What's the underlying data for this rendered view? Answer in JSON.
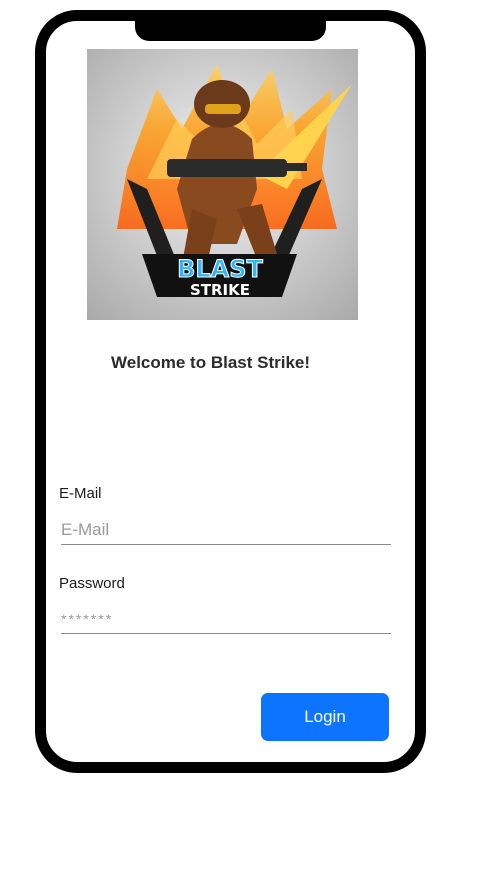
{
  "app": {
    "logo_top_text": "BLAST",
    "logo_bottom_text": "STRIKE",
    "welcome": "Welcome to Blast Strike!"
  },
  "form": {
    "email_label": "E-Mail",
    "email_placeholder": "E-Mail",
    "email_value": "",
    "password_label": "Password",
    "password_placeholder": "*******",
    "password_value": "",
    "login_label": "Login"
  },
  "colors": {
    "accent": "#0d74ff",
    "logo_blue": "#31b5ff",
    "fire": "#ff8a00"
  }
}
